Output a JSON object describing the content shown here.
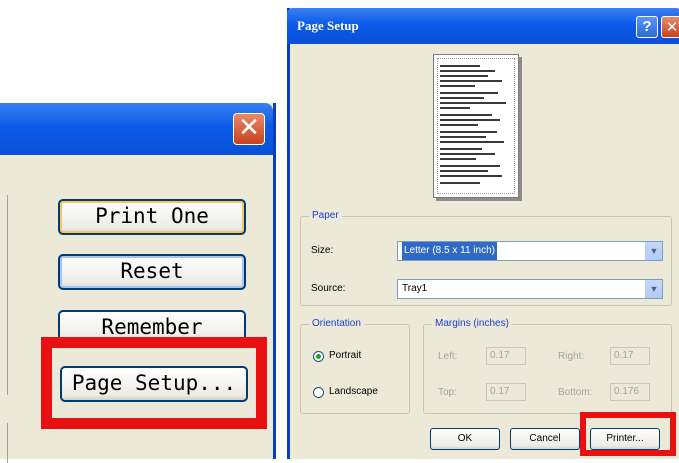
{
  "left_panel": {
    "close_glyph": "✕",
    "buttons": {
      "print_one": "Print One",
      "reset": "Reset",
      "remember": "Remember",
      "page_setup": "Page Setup..."
    }
  },
  "dialog": {
    "title": "Page Setup",
    "help_glyph": "?",
    "close_glyph": "✕",
    "paper": {
      "group_label": "Paper",
      "size_label": "Size:",
      "size_value": "Letter (8.5 x 11 inch)",
      "source_label": "Source:",
      "source_value": "Tray1"
    },
    "orientation": {
      "group_label": "Orientation",
      "portrait_label": "Portrait",
      "landscape_label": "Landscape",
      "selected": "Portrait"
    },
    "margins": {
      "group_label": "Margins (inches)",
      "left_label": "Left:",
      "left_value": "0.17",
      "right_label": "Right:",
      "right_value": "0.17",
      "top_label": "Top:",
      "top_value": "0.17",
      "bottom_label": "Bottom:",
      "bottom_value": "0.176"
    },
    "buttons": {
      "ok": "OK",
      "cancel": "Cancel",
      "printer": "Printer..."
    }
  },
  "highlight_color": "#e81010",
  "titlebar_color": "#0a50d8"
}
